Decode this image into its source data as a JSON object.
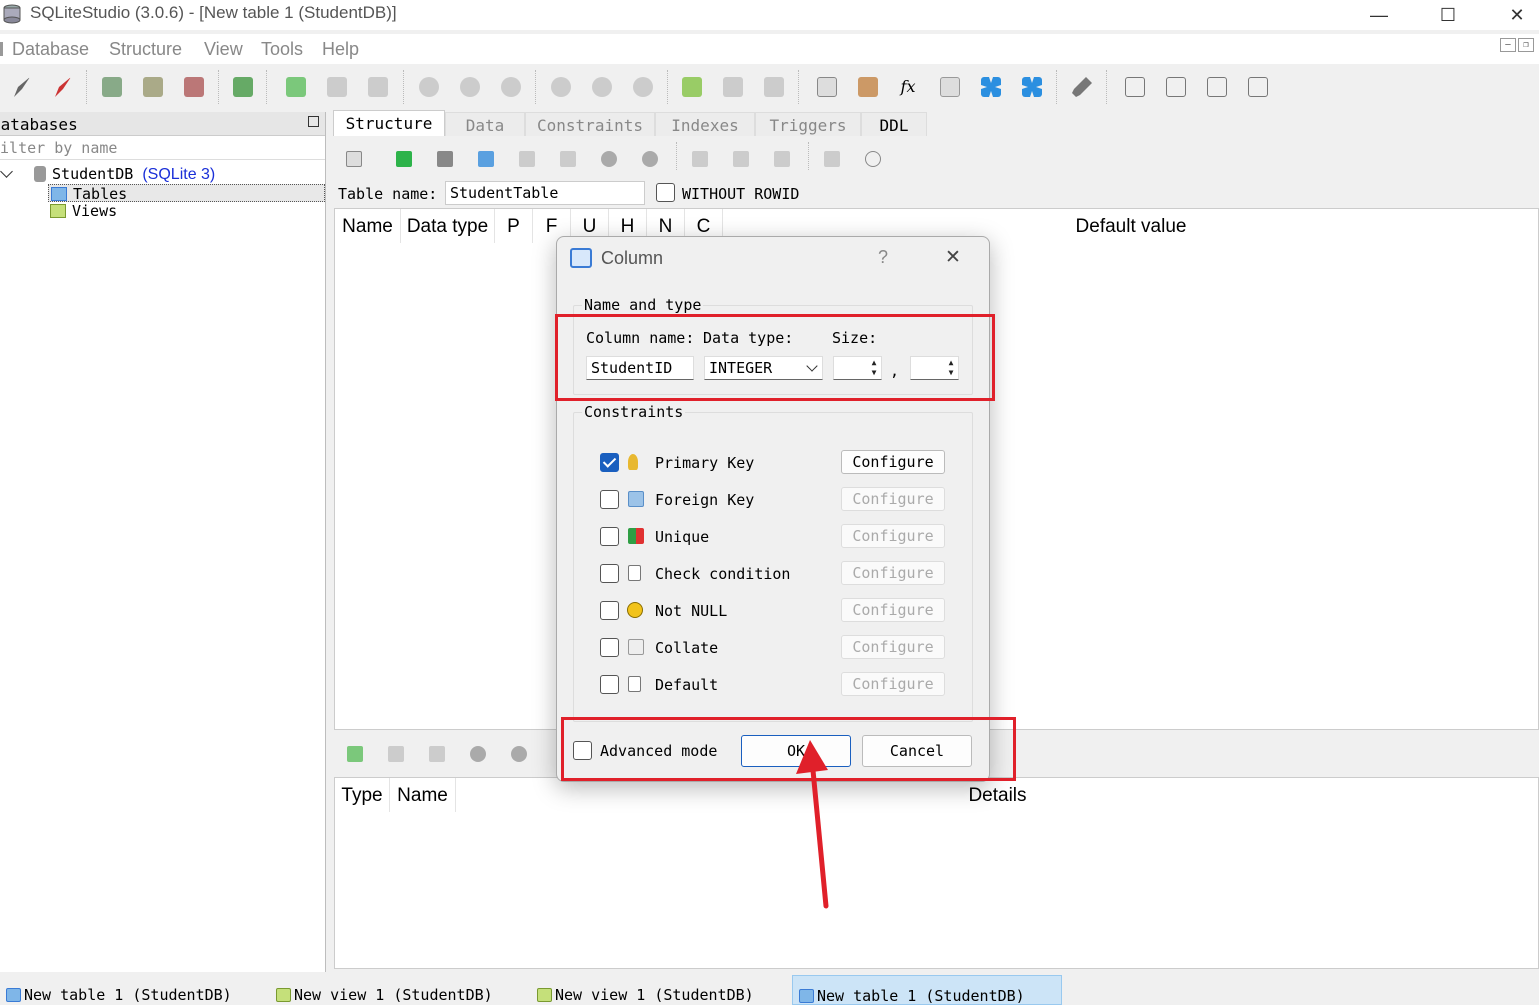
{
  "window": {
    "title": "SQLiteStudio (3.0.6) - [New table 1 (StudentDB)]",
    "minimize": "—",
    "maximize": "☐",
    "close": "✕"
  },
  "menu": [
    "Database",
    "Structure",
    "View",
    "Tools",
    "Help"
  ],
  "mdi_controls": [
    "–",
    "❐"
  ],
  "databases_panel": {
    "header": "Databases",
    "filter_placeholder": "Filter by name",
    "tree": {
      "db_name": "StudentDB",
      "db_type": "(SQLite 3)",
      "children": [
        "Tables",
        "Views"
      ]
    }
  },
  "tabs": [
    "Structure",
    "Data",
    "Constraints",
    "Indexes",
    "Triggers",
    "DDL"
  ],
  "structure": {
    "table_name_label": "Table name:",
    "table_name_value": "StudentTable",
    "without_rowid_label": "WITHOUT ROWID",
    "column_headers": [
      "Name",
      "Data type",
      "P",
      "F",
      "U",
      "H",
      "N",
      "C",
      "Default value"
    ],
    "constraint_headers": [
      "Type",
      "Name",
      "Details"
    ]
  },
  "taskbar": [
    "New table 1 (StudentDB)",
    "New view 1 (StudentDB)",
    "New view 1 (StudentDB)",
    "New table 1 (StudentDB)"
  ],
  "dialog": {
    "title": "Column",
    "help": "?",
    "close": "✕",
    "name_type_group": "Name and type",
    "column_name_label": "Column name:",
    "data_type_label": "Data type:",
    "size_label": "Size:",
    "column_name_value": "StudentID",
    "data_type_value": "INTEGER",
    "size_separator": ",",
    "constraints_group": "Constraints",
    "constraints": [
      {
        "label": "Primary Key",
        "checked": true,
        "configure": "Configure"
      },
      {
        "label": "Foreign Key",
        "checked": false,
        "configure": "Configure"
      },
      {
        "label": "Unique",
        "checked": false,
        "configure": "Configure"
      },
      {
        "label": "Check condition",
        "checked": false,
        "configure": "Configure"
      },
      {
        "label": "Not NULL",
        "checked": false,
        "configure": "Configure"
      },
      {
        "label": "Collate",
        "checked": false,
        "configure": "Configure"
      },
      {
        "label": "Default",
        "checked": false,
        "configure": "Configure"
      }
    ],
    "advanced_mode_label": "Advanced mode",
    "ok_label": "OK",
    "cancel_label": "Cancel"
  },
  "colors": {
    "accent": "#1a5fbf",
    "highlight": "#e0202a",
    "link": "#1a2fd8"
  }
}
